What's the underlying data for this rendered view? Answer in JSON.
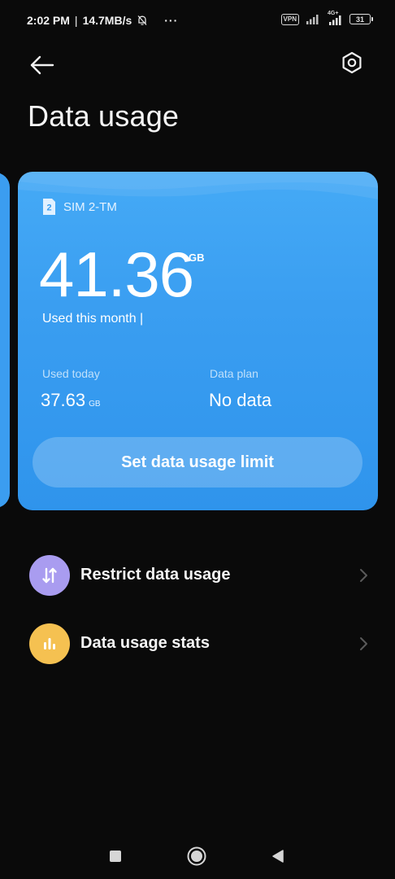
{
  "status_bar": {
    "time": "2:02 PM",
    "separator": "|",
    "speed": "14.7MB/s",
    "more": "···",
    "vpn": "VPN",
    "net_type": "4G+",
    "battery": "31"
  },
  "header": {
    "title": "Data usage"
  },
  "card": {
    "sim_label": "SIM 2-TM",
    "sim_number": "2",
    "used_value": "41.36",
    "used_unit": "GB",
    "used_caption": "Used this month |",
    "today_label": "Used today",
    "today_value": "37.63",
    "today_unit": "GB",
    "plan_label": "Data plan",
    "plan_value": "No data",
    "limit_button": "Set data usage limit"
  },
  "menu": {
    "items": [
      {
        "label": "Restrict data usage",
        "icon": "arrows-updown-icon",
        "color": "#a99cf0"
      },
      {
        "label": "Data usage stats",
        "icon": "bar-chart-icon",
        "color": "#f5c151"
      }
    ]
  },
  "colors": {
    "card": "#3a9ef1",
    "background": "#0a0a0a"
  }
}
